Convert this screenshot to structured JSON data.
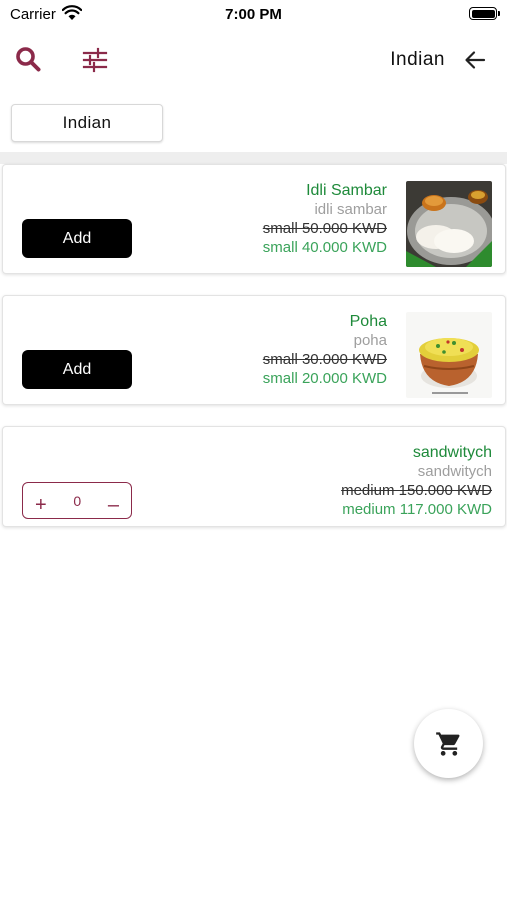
{
  "status_bar": {
    "carrier": "Carrier",
    "time": "7:00 PM"
  },
  "header": {
    "title": "Indian"
  },
  "filter_chip": {
    "label": "Indian"
  },
  "colors": {
    "accent": "#8b2a4a",
    "name_green": "#1e8a3a",
    "price_green": "#3aa35a"
  },
  "items": [
    {
      "name": "Idli Sambar",
      "subtitle": "idli sambar",
      "old_price": "small 50.000 KWD",
      "new_price": "small 40.000 KWD",
      "action": "Add"
    },
    {
      "name": "Poha",
      "subtitle": "poha",
      "old_price": "small 30.000 KWD",
      "new_price": "small 20.000 KWD",
      "action": "Add"
    },
    {
      "name": "sandwitych",
      "subtitle": "sandwitych",
      "old_price": "medium 150.000 KWD",
      "new_price": "medium 117.000 KWD",
      "quantity": "0",
      "plus": "+",
      "minus": "–"
    }
  ],
  "icons": {
    "search": "search-icon",
    "filter": "filter-icon",
    "back": "arrow-left-icon",
    "cart": "cart-icon"
  }
}
